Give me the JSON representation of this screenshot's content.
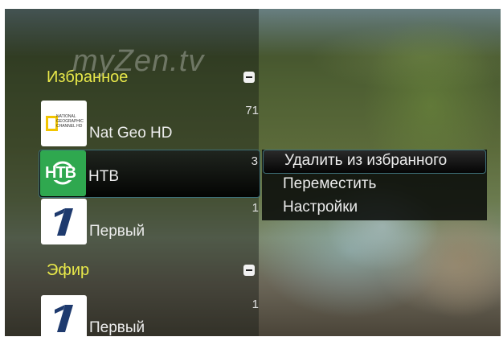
{
  "watermark": "myZen.tv",
  "sections": [
    {
      "label": "Избранное"
    },
    {
      "label": "Эфир"
    }
  ],
  "channels": {
    "favorites": [
      {
        "name": "Nat Geo HD",
        "number": "71",
        "logo_text": "NATIONAL GEOGRAPHIC CHANNEL HD"
      },
      {
        "name": "НТВ",
        "number": "3",
        "logo_text": "НТВ"
      },
      {
        "name": "Первый",
        "number": "1"
      }
    ],
    "air": [
      {
        "name": "Первый",
        "number": "1"
      }
    ]
  },
  "context_menu": {
    "items": [
      {
        "label": "Удалить из избранного"
      },
      {
        "label": "Переместить"
      },
      {
        "label": "Настройки"
      }
    ]
  },
  "colors": {
    "section_yellow": "#e8e84a",
    "selection_border": "#3d6f78",
    "ntv_green": "#2fa84f"
  }
}
